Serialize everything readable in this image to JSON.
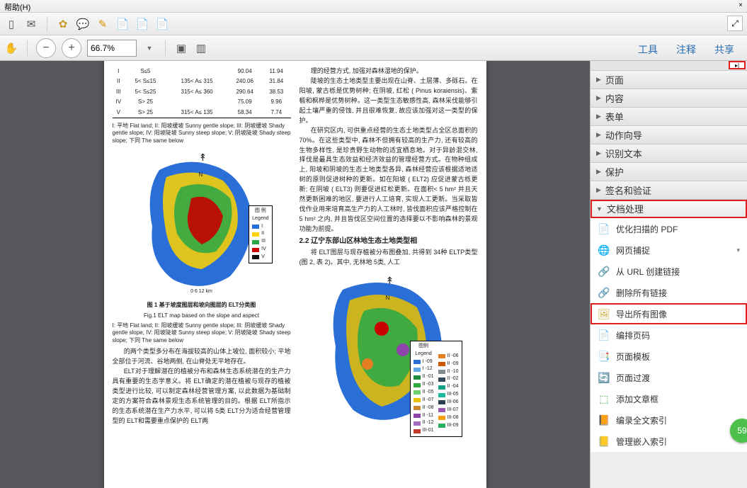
{
  "menubar": {
    "help": "帮助(H)",
    "close": "×"
  },
  "toolbar2": {
    "zoom_value": "66.7% "
  },
  "right_tabs": {
    "tools": "工具",
    "annot": "注释",
    "share": "共享"
  },
  "side_panels": {
    "page": "页面",
    "content": "内容",
    "forms": "表单",
    "action": "动作向导",
    "recognize": "识别文本",
    "protect": "保护",
    "sign": "签名和验证",
    "docproc": "文档处理"
  },
  "tool_items": {
    "optimize": "优化扫描的 PDF",
    "webcapture": "网页捕捉",
    "urllink": "从 URL 创建链接",
    "dellinks": "删除所有链接",
    "exportimg": "导出所有图像",
    "pagenum": "编排页码",
    "pagetpl": "页面模板",
    "pagetrans": "页面过渡",
    "addbox": "添加文章框",
    "fullidx": "编录全文索引",
    "embedidx": "管理嵌入索引"
  },
  "badge": "59",
  "doc": {
    "table_rows": [
      [
        "I",
        "S≤5",
        "",
        "90.04",
        "11.94"
      ],
      [
        "II",
        "5< S≤15",
        "135< A≤ 315",
        "240.06",
        "31.84"
      ],
      [
        "III",
        "5< S≤25",
        "315< A≤ 360",
        "290.64",
        "38.53"
      ],
      [
        "IV",
        "S> 25",
        "",
        "75.09",
        "9.96"
      ],
      [
        "V",
        "S> 25",
        "315< A≤ 135",
        "58.34",
        "7.74"
      ]
    ],
    "table_foot": "I: 平地 Flat land; II: 阳坡缓坡 Sunny gentle slope; III: 阴坡缓坡 Shady gentle slope; IV: 阳坡陡坡 Sunny steep slope; V: 阴坡陡坡 Shady steep slope; 下同 The same below",
    "fig1_cap_cn": "图 1  基于坡度图层和坡向图层的 ELT分类图",
    "fig1_cap_en": "Fig.1  ELT map based on the slope and aspect",
    "fig1_note": "I: 平地 Flat land; II: 阳坡缓坡 Sunny gentle slope; III: 阴坡缓坡 Shady gentle slope; IV: 阳坡陡坡 Sunny steep slope; V: 阴坡陡坡 Shady steep slope; 下同  The same below",
    "legend_label": "图 例\nLegend",
    "legend_items": [
      "I",
      "II",
      "III",
      "IV",
      "V"
    ],
    "legend_colors": [
      "#2a6ed8",
      "#ffd400",
      "#28a745",
      "#c80000",
      "#111111"
    ],
    "scale": "0      6     12 km",
    "left_p1": "的两个类型多分布在海拔较高的山体上坡位, 面积较小; 平地全部位于河流、谷地两侧, 在山脊处无平地存在。",
    "left_p2": "ELT对于理解潜在的植被分布和森林生态系统潜在的生产力具有重要的生态学意义。将 ELT确定的潜在植被与现存的植被类型进行比较, 可以制定森林经营管理方案, 以此数据为基础制定的方案符合森林景观生态系统管理的目的。根据 ELT所指示的生态系统潜在生产力水平, 可以将 5类 ELT分为适合经营管理型的 ELT和需要重点保护的 ELT两",
    "right_p1": "理的经营方式, 加强对森林湿地的保护。",
    "right_p2": "陡坡的生态土地类型主要出现在山脊、土层薄、多砾石。在阳坡, 蒙古栎是优势树种; 在阴坡, 红松 ( Pinus koraiensis)、紫椴和枫桦是优势树种。这一类型生态敏感性高, 森林采伐能够引起土壤严重的侵蚀, 并且很难恢复, 故应该加强对这一类型的保护。",
    "right_p3": "在研究区内, 可供重点经营的生态土地类型占全区总面积的 70%。在这些类型中, 森林不但拥有较高的生产力, 还有较高的生物多样性, 是珍贵野生动物的适宜栖息地。对于异龄混交林, 择伐是最具生态效益和经济效益的管理经营方式。在物种组成上, 阳坡和阴坡的生态土地类型各异, 森林经营应该根据适地适树的原则促进树种的更新。如在阳坡 ( ELT2) 应促进蒙古栎更新; 在阴坡 ( ELT3) 则要促进红松更新。在面积< 5 hm² 并且天然更新困难的地区, 要进行人工培育, 实现人工更新。当采取皆伐作业用来培育高生产力的人工林时, 皆伐面积应该严格控制在 5 hm² 之内, 并且皆伐区空间位置的选择要以不影响森林的景观功能为前提。",
    "sect22": "2.2  辽宁东部山区林地生态土地类型相",
    "right_p4": "将 ELT图层与现存植被分布图叠加, 共得到 34种 ELTP类型 (图 2, 表 2)。其中, 无林地 5类, 人工",
    "legend2_label": "图例\nLegend",
    "legend2_left": [
      "I -09",
      "I -12",
      "II -01",
      "II -03",
      "II -05",
      "II -07",
      "II -08",
      "II -11",
      "II -12",
      "III-01"
    ],
    "legend2_right": [
      "II -06",
      "II -09",
      "II -10",
      "II -02",
      "II -04",
      "III-05",
      "III-06",
      "III-07",
      "III-08",
      "III-09"
    ]
  }
}
